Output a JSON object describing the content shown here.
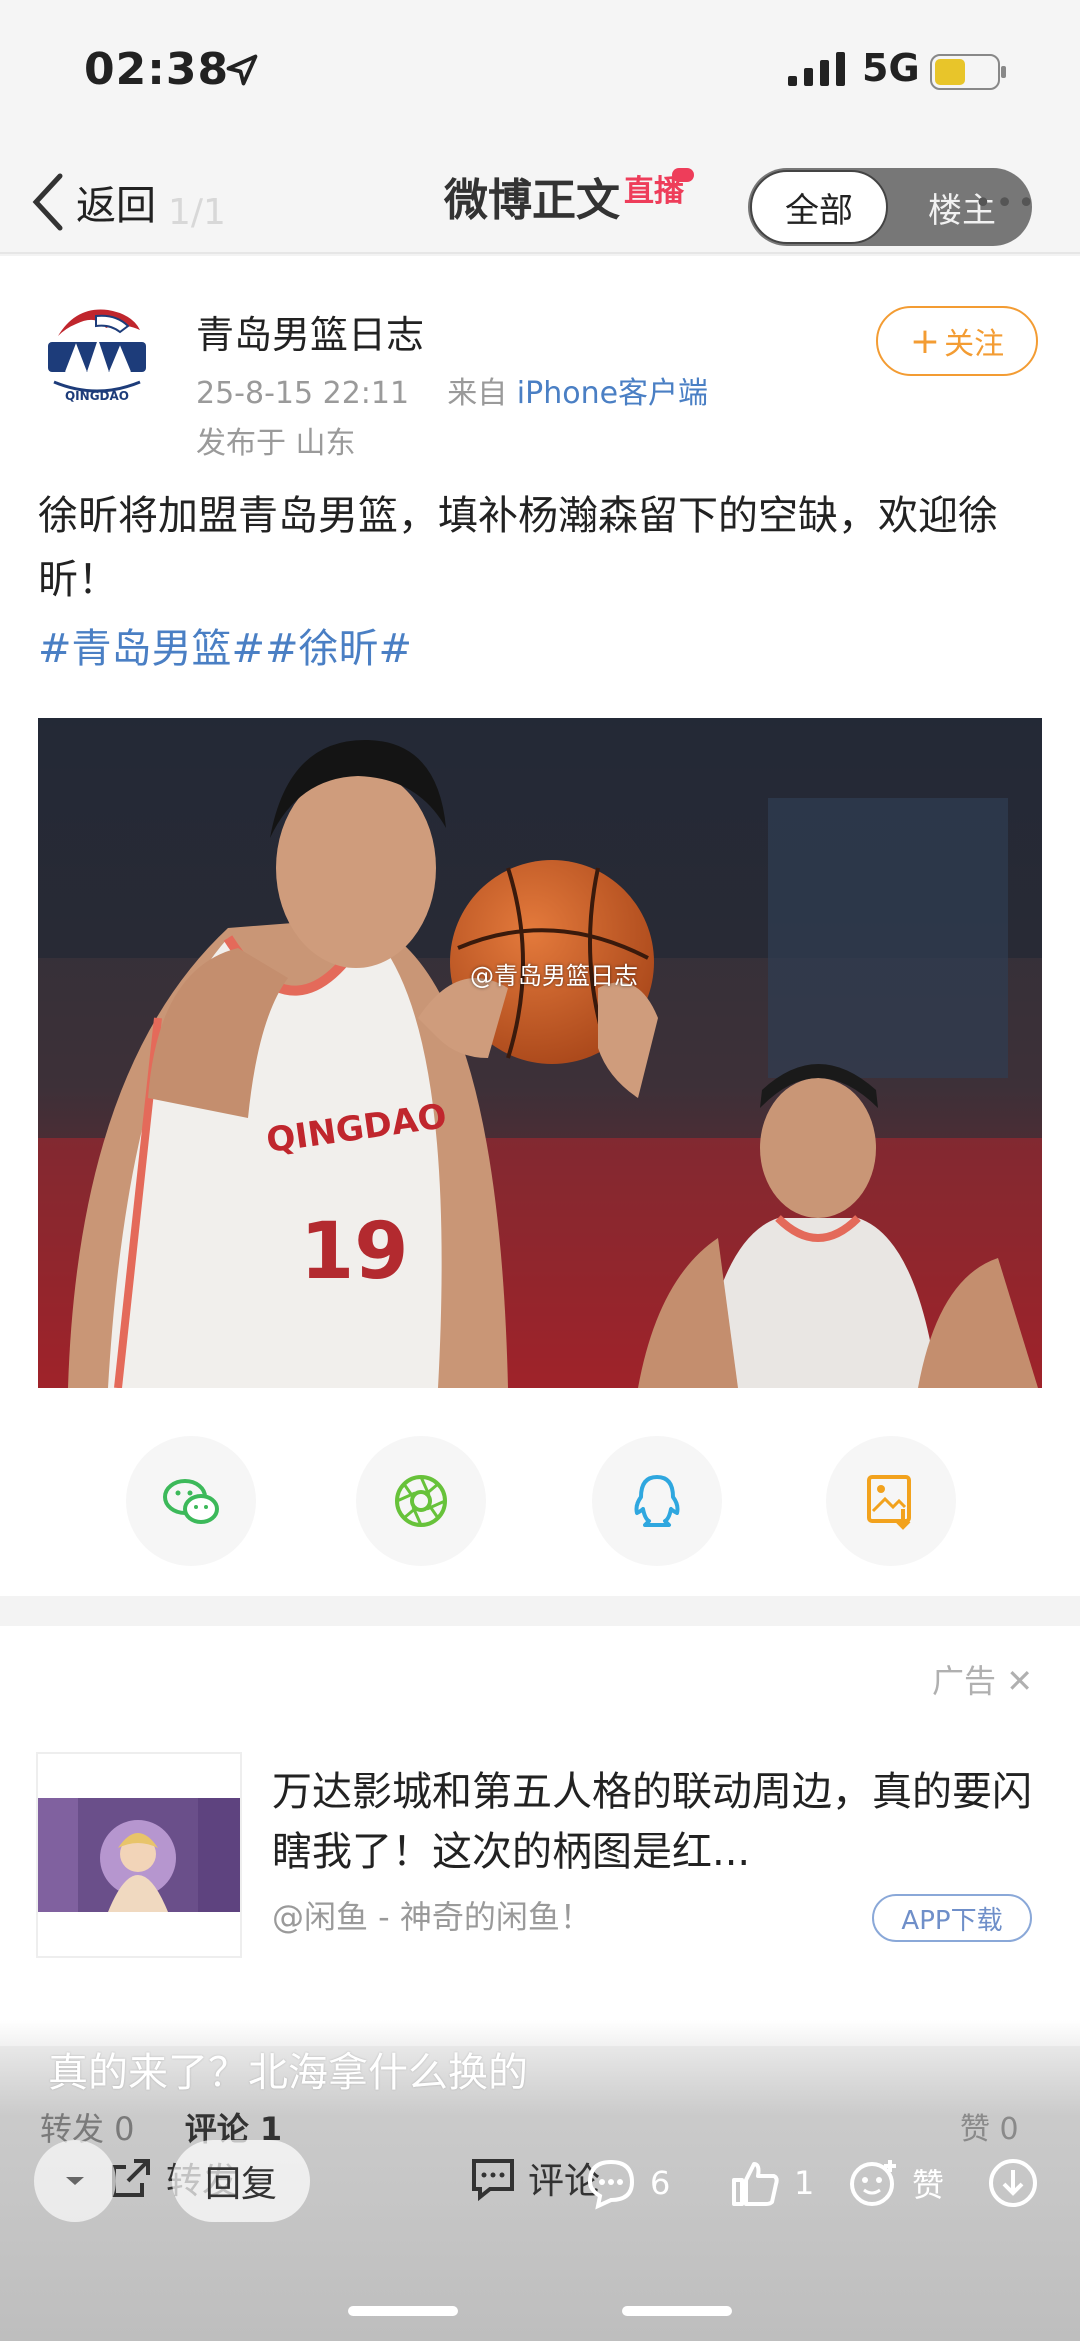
{
  "status": {
    "time": "02:38",
    "network": "5G"
  },
  "nav": {
    "back_label": "返回",
    "page_index": "1/1",
    "title": "微博正文",
    "live_badge": "直播",
    "seg_all": "全部",
    "seg_op": "楼主",
    "more": "•••"
  },
  "post": {
    "author": "青岛男篮日志",
    "datetime": "25-8-15 22:11",
    "source_prefix": "来自",
    "source": "iPhone客户端",
    "location": "发布于 山东",
    "follow_label": "关注",
    "text": "徐昕将加盟青岛男篮，填补杨瀚森留下的空缺，欢迎徐昕！",
    "tags": "#青岛男篮##徐昕#",
    "watermark": "@青岛男篮日志",
    "jersey_number": "19",
    "share_icons": [
      "wechat-icon",
      "moments-icon",
      "qq-icon",
      "save-image-icon"
    ]
  },
  "ad": {
    "label": "广告",
    "title": "万达影城和第五人格的联动周边，真的要闪瞎我了！这次的柄图是红...",
    "source": "@闲鱼 - 神奇的闲鱼！",
    "cta": "APP下载"
  },
  "bottom": {
    "comment_preview": "真的来了？北海拿什么换的",
    "tab_repost": "转发 0",
    "tab_comment": "评论 1",
    "tab_likes": "赞 0",
    "repost_label": "转发",
    "reply_label": "回复",
    "comment_label": "评论",
    "comment_count": "6",
    "like_count": "1",
    "like_label": "赞"
  },
  "colors": {
    "accent_orange": "#f39c33",
    "link_blue": "#4a7fc4",
    "live_red": "#ee3d5a"
  }
}
